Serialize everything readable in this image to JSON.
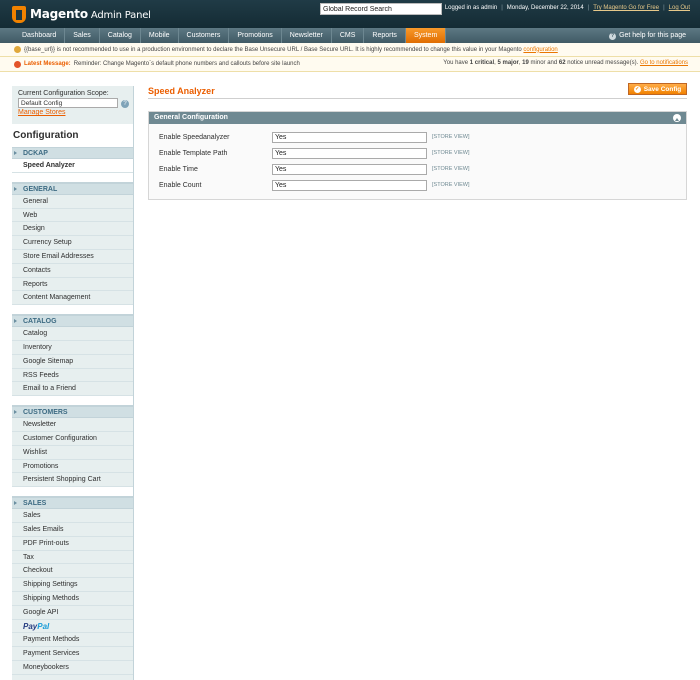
{
  "header": {
    "brand": "Magento",
    "brand_sub": "Admin Panel",
    "search_value": "Global Record Search",
    "logged_in": "Logged in as admin",
    "date": "Monday, December 22, 2014",
    "try_link": "Try Magento Go for Free",
    "logout": "Log Out"
  },
  "nav": {
    "items": [
      "Dashboard",
      "Sales",
      "Catalog",
      "Mobile",
      "Customers",
      "Promotions",
      "Newsletter",
      "CMS",
      "Reports",
      "System"
    ],
    "active": "System",
    "help": "Get help for this page"
  },
  "notices": {
    "base_url_text": "{{base_url}} is not recommended to use in a production environment to declare the Base Unsecure URL / Base Secure URL. It is highly recommended to change this value in your Magento",
    "base_url_link": "configuration",
    "latest_label": "Latest Message:",
    "latest_text": "Reminder: Change Magento`s default phone numbers and callouts before site launch",
    "counts_prefix": "You have",
    "critical": "1 critical",
    "major": "5 major",
    "minor": "19",
    "minor_suffix": "minor and",
    "notice": "62",
    "notice_suffix": "notice unread message(s).",
    "go_link": "Go to notifications"
  },
  "sidebar": {
    "scope_label": "Current Configuration Scope:",
    "scope_value": "Default Config",
    "manage_stores": "Manage Stores",
    "title": "Configuration",
    "sections": [
      {
        "name": "DCKAP",
        "items": [
          "Speed Analyzer"
        ]
      },
      {
        "name": "GENERAL",
        "items": [
          "General",
          "Web",
          "Design",
          "Currency Setup",
          "Store Email Addresses",
          "Contacts",
          "Reports",
          "Content Management"
        ]
      },
      {
        "name": "CATALOG",
        "items": [
          "Catalog",
          "Inventory",
          "Google Sitemap",
          "RSS Feeds",
          "Email to a Friend"
        ]
      },
      {
        "name": "CUSTOMERS",
        "items": [
          "Newsletter",
          "Customer Configuration",
          "Wishlist",
          "Promotions",
          "Persistent Shopping Cart"
        ]
      },
      {
        "name": "SALES",
        "items": [
          "Sales",
          "Sales Emails",
          "PDF Print-outs",
          "Tax",
          "Checkout",
          "Shipping Settings",
          "Shipping Methods",
          "Google API",
          "PayPal",
          "Payment Methods",
          "Payment Services",
          "Moneybookers"
        ]
      }
    ],
    "active_item": "Speed Analyzer",
    "paypal_parts": [
      "Pay",
      "Pal"
    ]
  },
  "main": {
    "title": "Speed Analyzer",
    "save_label": "Save Config",
    "fieldset_title": "General Configuration",
    "fields": [
      {
        "label": "Enable Speedanalyzer",
        "value": "Yes",
        "scope": "[STORE VIEW]"
      },
      {
        "label": "Enable Template Path",
        "value": "Yes",
        "scope": "[STORE VIEW]"
      },
      {
        "label": "Enable Time",
        "value": "Yes",
        "scope": "[STORE VIEW]"
      },
      {
        "label": "Enable Count",
        "value": "Yes",
        "scope": "[STORE VIEW]"
      }
    ]
  },
  "colors": {
    "header_bg": "#1c3742",
    "nav_bg": "#4a6470",
    "accent": "#eb5e00",
    "active_tab": "#f37d0c",
    "sidebar_bg": "#e7efef",
    "fieldset_head": "#6f8992"
  }
}
